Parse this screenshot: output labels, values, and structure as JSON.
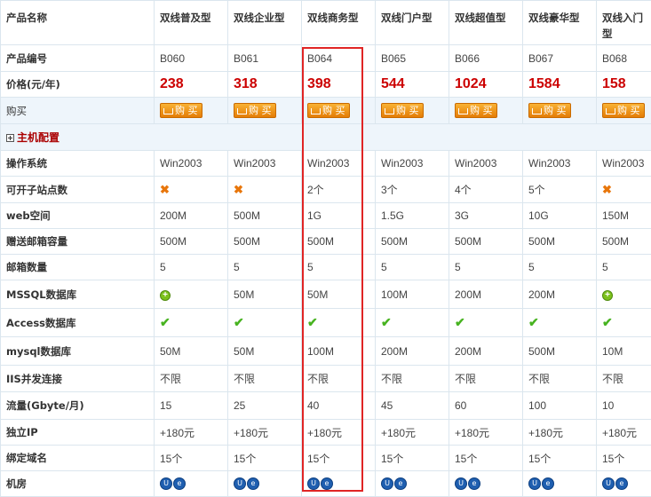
{
  "header": {
    "label": "产品名称",
    "products": [
      "双线普及型",
      "双线企业型",
      "双线商务型",
      "双线门户型",
      "双线超值型",
      "双线豪华型",
      "双线入门型"
    ]
  },
  "codes": {
    "label": "产品编号",
    "values": [
      "B060",
      "B061",
      "B064",
      "B065",
      "B066",
      "B067",
      "B068"
    ]
  },
  "prices": {
    "label": "价格(元/年)",
    "values": [
      "238",
      "318",
      "398",
      "544",
      "1024",
      "1584",
      "158"
    ]
  },
  "buy": {
    "label": "购买",
    "button": "购 买"
  },
  "section": {
    "label": "主机配置"
  },
  "rows": [
    {
      "label": "操作系统",
      "cells": [
        {
          "t": "text",
          "v": "Win2003"
        },
        {
          "t": "text",
          "v": "Win2003"
        },
        {
          "t": "text",
          "v": "Win2003"
        },
        {
          "t": "text",
          "v": "Win2003"
        },
        {
          "t": "text",
          "v": "Win2003"
        },
        {
          "t": "text",
          "v": "Win2003"
        },
        {
          "t": "text",
          "v": "Win2003"
        }
      ]
    },
    {
      "label": "可开子站点数",
      "cells": [
        {
          "t": "x-icon"
        },
        {
          "t": "x-icon"
        },
        {
          "t": "text",
          "v": "2个"
        },
        {
          "t": "text",
          "v": "3个"
        },
        {
          "t": "text",
          "v": "4个"
        },
        {
          "t": "text",
          "v": "5个"
        },
        {
          "t": "x-icon"
        }
      ]
    },
    {
      "label": "web空间",
      "cells": [
        {
          "t": "text",
          "v": "200M"
        },
        {
          "t": "text",
          "v": "500M"
        },
        {
          "t": "text",
          "v": "1G"
        },
        {
          "t": "text",
          "v": "1.5G"
        },
        {
          "t": "text",
          "v": "3G"
        },
        {
          "t": "text",
          "v": "10G"
        },
        {
          "t": "text",
          "v": "150M"
        }
      ]
    },
    {
      "label": "赠送邮箱容量",
      "cells": [
        {
          "t": "text",
          "v": "500M"
        },
        {
          "t": "text",
          "v": "500M"
        },
        {
          "t": "text",
          "v": "500M"
        },
        {
          "t": "text",
          "v": "500M"
        },
        {
          "t": "text",
          "v": "500M"
        },
        {
          "t": "text",
          "v": "500M"
        },
        {
          "t": "text",
          "v": "500M"
        }
      ]
    },
    {
      "label": "邮箱数量",
      "cells": [
        {
          "t": "text",
          "v": "5"
        },
        {
          "t": "text",
          "v": "5"
        },
        {
          "t": "text",
          "v": "5"
        },
        {
          "t": "text",
          "v": "5"
        },
        {
          "t": "text",
          "v": "5"
        },
        {
          "t": "text",
          "v": "5"
        },
        {
          "t": "text",
          "v": "5"
        }
      ]
    },
    {
      "label": "MSSQL数据库",
      "cells": [
        {
          "t": "plus-icon"
        },
        {
          "t": "text",
          "v": "50M"
        },
        {
          "t": "text",
          "v": "50M"
        },
        {
          "t": "text",
          "v": "100M"
        },
        {
          "t": "text",
          "v": "200M"
        },
        {
          "t": "text",
          "v": "200M"
        },
        {
          "t": "plus-icon"
        }
      ]
    },
    {
      "label": "Access数据库",
      "cells": [
        {
          "t": "check-icon"
        },
        {
          "t": "check-icon"
        },
        {
          "t": "check-icon"
        },
        {
          "t": "check-icon"
        },
        {
          "t": "check-icon"
        },
        {
          "t": "check-icon"
        },
        {
          "t": "check-icon"
        }
      ]
    },
    {
      "label": "mysql数据库",
      "cells": [
        {
          "t": "text",
          "v": "50M"
        },
        {
          "t": "text",
          "v": "50M"
        },
        {
          "t": "text",
          "v": "100M"
        },
        {
          "t": "text",
          "v": "200M"
        },
        {
          "t": "text",
          "v": "200M"
        },
        {
          "t": "text",
          "v": "500M"
        },
        {
          "t": "text",
          "v": "10M"
        }
      ]
    },
    {
      "label": "IIS并发连接",
      "cells": [
        {
          "t": "text",
          "v": "不限"
        },
        {
          "t": "text",
          "v": "不限"
        },
        {
          "t": "text",
          "v": "不限"
        },
        {
          "t": "text",
          "v": "不限"
        },
        {
          "t": "text",
          "v": "不限"
        },
        {
          "t": "text",
          "v": "不限"
        },
        {
          "t": "text",
          "v": "不限"
        }
      ]
    },
    {
      "label": "流量(Gbyte/月)",
      "cells": [
        {
          "t": "text",
          "v": "15"
        },
        {
          "t": "text",
          "v": "25"
        },
        {
          "t": "text",
          "v": "40"
        },
        {
          "t": "text",
          "v": "45"
        },
        {
          "t": "text",
          "v": "60"
        },
        {
          "t": "text",
          "v": "100"
        },
        {
          "t": "text",
          "v": "10"
        }
      ]
    },
    {
      "label": "独立IP",
      "cells": [
        {
          "t": "text",
          "v": "+180元"
        },
        {
          "t": "text",
          "v": "+180元"
        },
        {
          "t": "text",
          "v": "+180元"
        },
        {
          "t": "text",
          "v": "+180元"
        },
        {
          "t": "text",
          "v": "+180元"
        },
        {
          "t": "text",
          "v": "+180元"
        },
        {
          "t": "text",
          "v": "+180元"
        }
      ]
    },
    {
      "label": "绑定域名",
      "cells": [
        {
          "t": "text",
          "v": "15个"
        },
        {
          "t": "text",
          "v": "15个"
        },
        {
          "t": "text",
          "v": "15个"
        },
        {
          "t": "text",
          "v": "15个"
        },
        {
          "t": "text",
          "v": "15个"
        },
        {
          "t": "text",
          "v": "15个"
        },
        {
          "t": "text",
          "v": "15个"
        }
      ]
    },
    {
      "label": "机房",
      "cells": [
        {
          "t": "net-icon"
        },
        {
          "t": "net-icon"
        },
        {
          "t": "net-icon"
        },
        {
          "t": "net-icon"
        },
        {
          "t": "net-icon"
        },
        {
          "t": "net-icon"
        },
        {
          "t": "net-icon"
        }
      ]
    }
  ],
  "colors": {
    "price": "#cc0000",
    "highlight": "#e02525",
    "buy_button": "#f39a1e",
    "section_text": "#aa0000"
  }
}
